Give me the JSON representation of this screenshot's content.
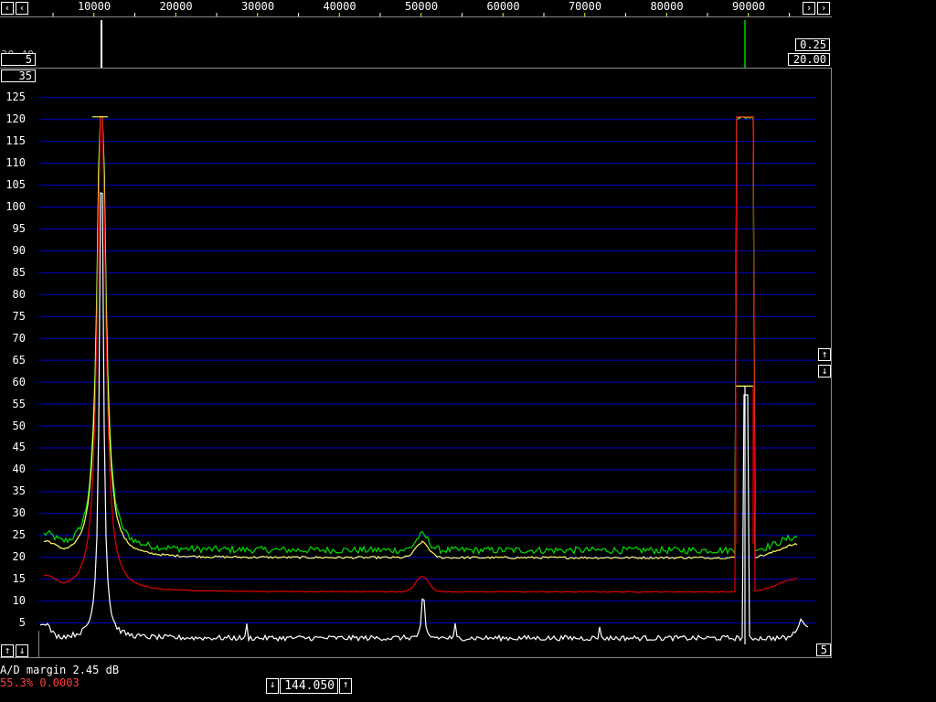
{
  "app": {
    "freq_axis": {
      "labels": [
        "10000",
        "20000",
        "30000",
        "40000",
        "50000",
        "60000",
        "70000",
        "80000",
        "90000"
      ]
    },
    "waterfall": {
      "left_value": "5",
      "left_clipped_label": "30 40",
      "right_top_value": "0.25",
      "right_bottom_value": "20.00"
    },
    "spectrum": {
      "top_value_box": "35",
      "y_labels": [
        "125",
        "120",
        "115",
        "110",
        "105",
        "100",
        "95",
        "90",
        "85",
        "80",
        "75",
        "70",
        "65",
        "60",
        "55",
        "50",
        "45",
        "40",
        "35",
        "30",
        "25",
        "20",
        "15",
        "10",
        "5"
      ],
      "bottom_right_value": "5"
    },
    "status": {
      "ad_margin": "A/D margin 2.45 dB",
      "cpu_line": "55.3% 0.0003"
    },
    "frequency_box": {
      "value": "144.050"
    },
    "icons": {
      "left": "chevron-left-icon",
      "right": "chevron-right-icon",
      "up": "arrow-up-icon",
      "down": "arrow-down-icon"
    },
    "colors": {
      "grid": "#0000c8",
      "green_trace": "#00e000",
      "yellow_trace": "#ffff60",
      "red_trace": "#e00000",
      "white_trace": "#ffffff",
      "status_red": "#ff4040",
      "marker_green": "#00a000"
    }
  }
}
